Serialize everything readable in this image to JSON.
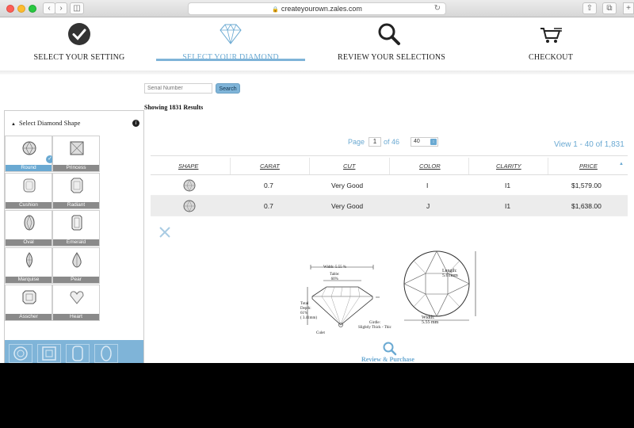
{
  "browser": {
    "url": "createyourown.zales.com",
    "plus": "+"
  },
  "steps": [
    {
      "label": "SELECT YOUR SETTING"
    },
    {
      "label": "SELECT YOUR DIAMOND"
    },
    {
      "label": "REVIEW YOUR SELECTIONS"
    },
    {
      "label": "CHECKOUT"
    }
  ],
  "search": {
    "placeholder": "Serial Number",
    "button": "Search"
  },
  "results": {
    "showing": "Showing 1831 Results"
  },
  "sidebar": {
    "title": "Select Diamond Shape",
    "info": "i",
    "shapes": [
      {
        "label": "Round",
        "selected": true
      },
      {
        "label": "Princess"
      },
      {
        "label": "Cushion"
      },
      {
        "label": "Radiant"
      },
      {
        "label": "Oval"
      },
      {
        "label": "Emerald"
      },
      {
        "label": "Marquise"
      },
      {
        "label": "Pear"
      },
      {
        "label": "Asscher"
      },
      {
        "label": "Heart"
      }
    ]
  },
  "pagination": {
    "page_label": "Page",
    "page": "1",
    "of_label": "of 46",
    "per_page": "40",
    "view_count": "View 1 - 40 of 1,831"
  },
  "table": {
    "headers": [
      "SHAPE",
      "CARAT",
      "CUT",
      "COLOR",
      "CLARITY",
      "PRICE"
    ],
    "rows": [
      {
        "carat": "0.7",
        "cut": "Very Good",
        "color": "I",
        "clarity": "I1",
        "price": "$1,579.00"
      },
      {
        "carat": "0.7",
        "cut": "Very Good",
        "color": "J",
        "clarity": "I1",
        "price": "$1,638.00"
      }
    ]
  },
  "diagram": {
    "width_top": "Width: 5.55 %",
    "table": "Table:",
    "table_pct": "60%",
    "total": "Total",
    "depth": "Depth:",
    "depth_pct": "61%",
    "depth_mm": "( 3.41mm)",
    "girdle": "Girdle:",
    "girdle_val": "Slightly Thick - Thic",
    "culet": "Culet",
    "length": "Length:",
    "length_val": "5.61mm",
    "width": "Width:",
    "width_val": "5.55 mm"
  },
  "review": {
    "label": "Review & Purchase"
  },
  "colors": {
    "accent": "#6aa9d2",
    "accent_bar": "#7fb4d8",
    "shape_caption": "#8a8a8a"
  }
}
